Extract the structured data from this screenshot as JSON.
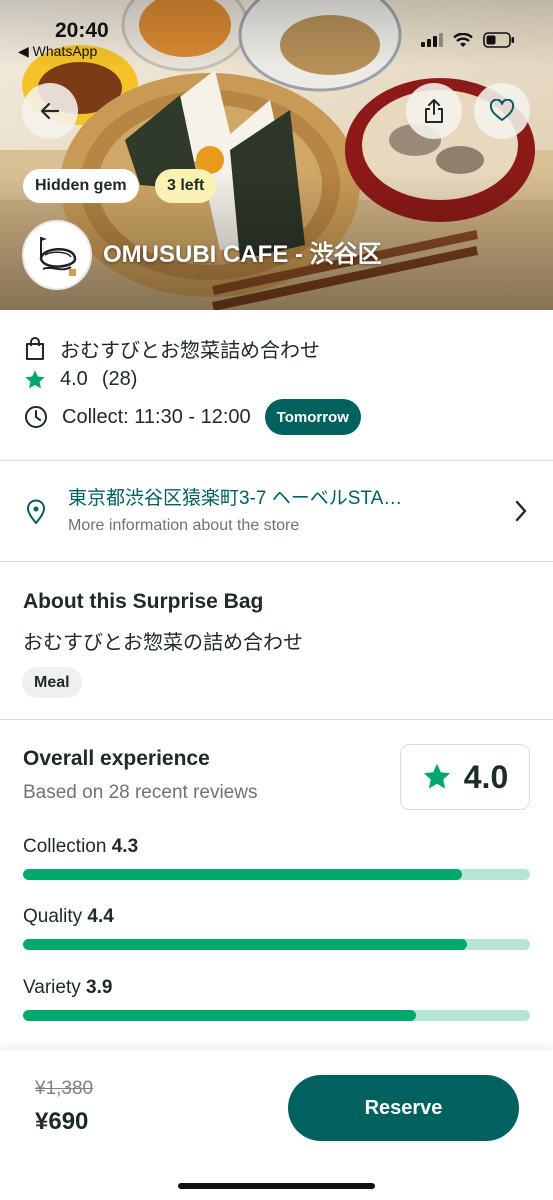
{
  "status_bar": {
    "time": "20:40",
    "back_app": "◀ WhatsApp",
    "icons": [
      "signal-icon",
      "wifi-icon",
      "battery-icon"
    ]
  },
  "hero": {
    "badges": [
      "Hidden gem",
      "3 left"
    ],
    "store_name": "OMUSUBI CAFE - 渋谷区",
    "icons": [
      "back-arrow-icon",
      "share-icon",
      "heart-icon"
    ]
  },
  "info": {
    "bag_name": "おむすびとお惣菜詰め合わせ",
    "rating": "4.0",
    "rating_count": "(28)",
    "collect": "Collect: 11:30 - 12:00",
    "collect_day": "Tomorrow"
  },
  "address": {
    "line": "東京都渋谷区猿楽町3-7 ヘーベルSTA…",
    "more": "More information about the store"
  },
  "about": {
    "title": "About this Surprise Bag",
    "description": "おむすびとお惣菜の詰め合わせ",
    "category": "Meal"
  },
  "experience": {
    "title": "Overall experience",
    "subtitle": "Based on 28 recent reviews",
    "score": "4.0",
    "metrics": [
      {
        "label": "Collection",
        "score": "4.3",
        "fraction": 0.865
      },
      {
        "label": "Quality",
        "score": "4.4",
        "fraction": 0.875
      },
      {
        "label": "Variety",
        "score": "3.9",
        "fraction": 0.775
      }
    ]
  },
  "footer": {
    "old_price": "¥1,380",
    "price": "¥690",
    "reserve_label": "Reserve"
  },
  "colors": {
    "brand": "#00615f",
    "bar_fill": "#00a86b",
    "bar_track": "#b6e6d3",
    "star": "#00a86b",
    "badge_yellow": "#fbf1b3"
  }
}
